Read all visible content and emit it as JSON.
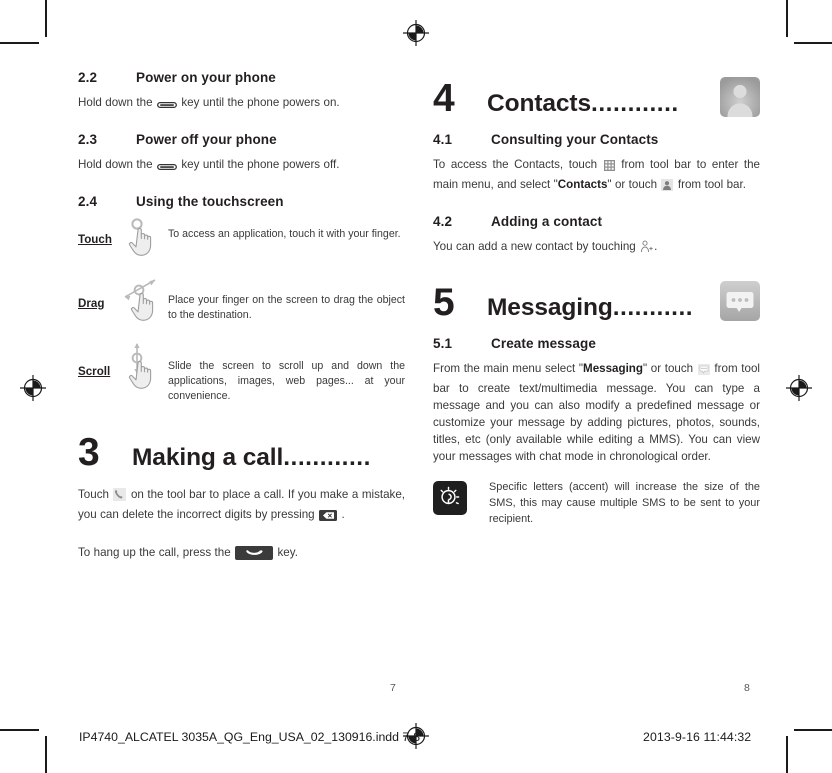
{
  "document": {
    "type": "printed-manual-spread",
    "footer_filename": "IP4740_ALCATEL 3035A_QG_Eng_USA_02_130916.indd   7-8",
    "footer_date": "2013-9-16   11:44:32",
    "page_number_left": "7",
    "page_number_right": "8"
  },
  "left_column": {
    "section_2_2": {
      "number": "2.2",
      "title": "Power on your phone",
      "body_before": "Hold down the ",
      "icon": "power-key-icon",
      "body_after": " key until the phone powers on."
    },
    "section_2_3": {
      "number": "2.3",
      "title": "Power off your phone",
      "body_before": "Hold down the ",
      "icon": "power-key-icon",
      "body_after": " key until the phone powers off."
    },
    "section_2_4": {
      "number": "2.4",
      "title": "Using the touchscreen"
    },
    "gestures": [
      {
        "label": "Touch",
        "icon": "touch-hand-icon",
        "text": "To access an application, touch it with your finger."
      },
      {
        "label": "Drag",
        "icon": "drag-hand-icon",
        "text": "Place your finger on the screen to drag the object to the destination."
      },
      {
        "label": "Scroll",
        "icon": "scroll-hand-icon",
        "text": "Slide the screen to scroll up and down the applications, images, web pages... at your convenience."
      }
    ],
    "chapter_3": {
      "number": "3",
      "name": "Making a call",
      "leader": "............",
      "paragraph_1_a": "Touch ",
      "paragraph_1_icon": "phone-handset-icon",
      "paragraph_1_b": " on the tool bar to place a call. If you make a mistake, you can delete the incorrect digits by pressing ",
      "paragraph_1_icon2": "backspace-key-icon",
      "paragraph_1_c": " .",
      "paragraph_2_a": "To hang up the call, press the ",
      "paragraph_2_icon": "end-call-key-icon",
      "paragraph_2_b": " key."
    }
  },
  "right_column": {
    "chapter_4": {
      "number": "4",
      "name": "Contacts",
      "leader": "............",
      "app_icon": "contacts-app-icon"
    },
    "section_4_1": {
      "number": "4.1",
      "title": "Consulting your Contacts",
      "text_a": "To access the Contacts, touch ",
      "icon_1": "main-menu-grid-icon",
      "text_b": " from tool bar to enter the main menu, and select \"",
      "bold_1": "Contacts",
      "text_c": "\" or touch ",
      "icon_2": "contacts-person-icon",
      "text_d": " from tool bar."
    },
    "section_4_2": {
      "number": "4.2",
      "title": "Adding a contact",
      "text_a": "You can add a new contact by touching ",
      "icon_1": "add-contact-icon",
      "text_b": "."
    },
    "chapter_5": {
      "number": "5",
      "name": "Messaging",
      "leader": "...........",
      "app_icon": "messaging-app-icon"
    },
    "section_5_1": {
      "number": "5.1",
      "title": "Create message",
      "text_a": "From the main menu select \"",
      "bold_1": "Messaging",
      "text_b": "\" or touch ",
      "icon_1": "messaging-bubble-icon",
      "text_c": " from tool bar to create text/multimedia message. You can type a message and you can also modify a predefined message or customize your message by adding pictures, photos, sounds, titles, etc (only available while editing a MMS). You can view your messages with chat mode in chronological order."
    },
    "tip": {
      "icon": "tip-bulb-icon",
      "text": "Specific letters (accent) will increase the size of the SMS, this may cause multiple SMS to be sent to your recipient."
    }
  },
  "colors": {
    "text": "#231f20",
    "body_text": "#3a3a3a",
    "page_number": "#55595c",
    "crop_mark": "#1a1a1a"
  }
}
